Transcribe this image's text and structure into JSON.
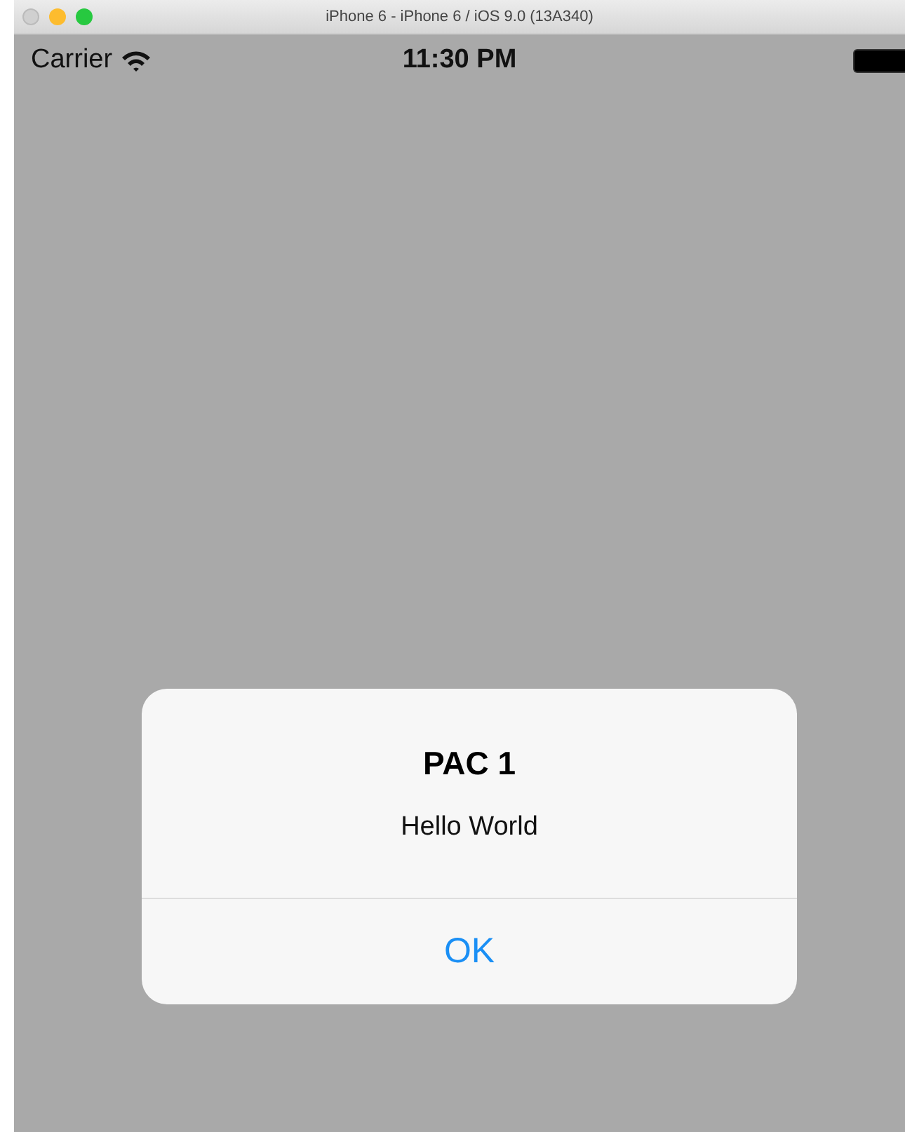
{
  "window": {
    "title": "iPhone 6 - iPhone 6 / iOS 9.0 (13A340)"
  },
  "status_bar": {
    "carrier": "Carrier",
    "time": "11:30 PM"
  },
  "alert": {
    "title": "PAC 1",
    "message": "Hello World",
    "buttons": [
      "OK"
    ]
  }
}
